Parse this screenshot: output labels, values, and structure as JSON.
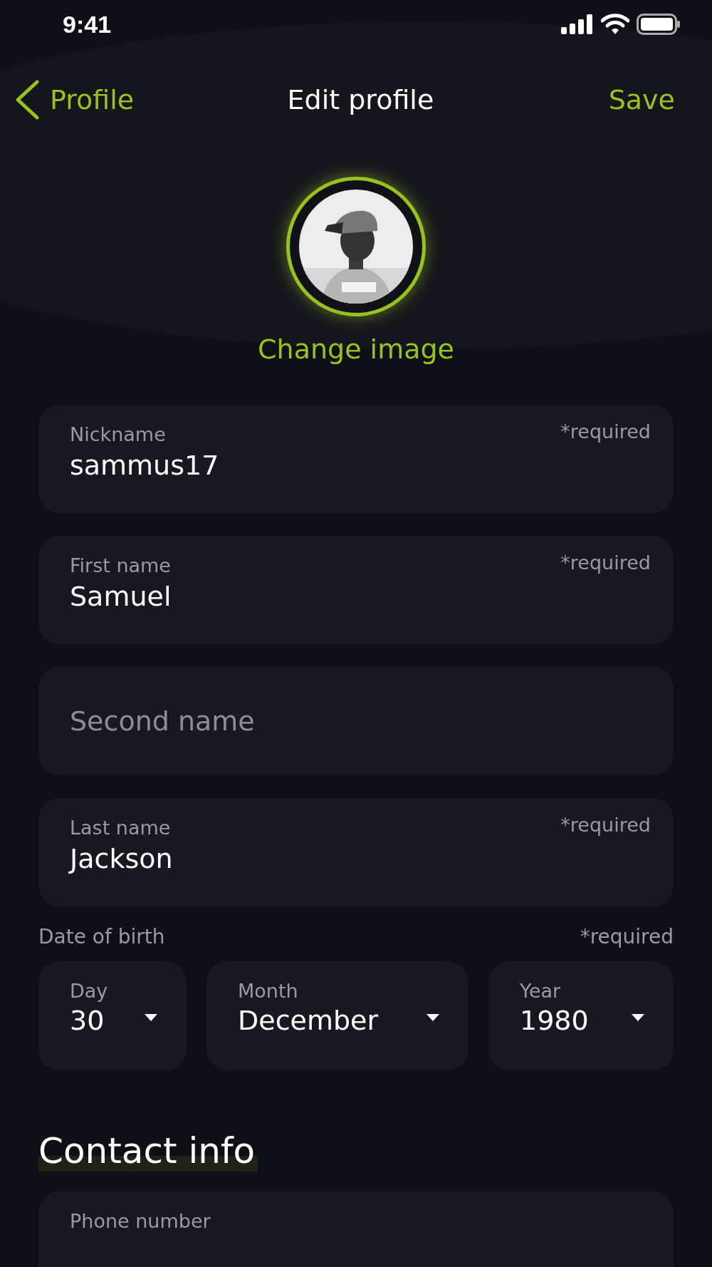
{
  "status_bar": {
    "time": "9:41"
  },
  "nav": {
    "back": "Profile",
    "title": "Edit profile",
    "action": "Save"
  },
  "avatar": {
    "change": "Change image"
  },
  "fields": [
    {
      "label": "Nickname",
      "value": "sammus17",
      "required": "*required"
    },
    {
      "label": "First name",
      "value": "Samuel",
      "required": "*required"
    },
    {
      "placeholder": "Second name"
    },
    {
      "label": "Last name",
      "value": "Jackson",
      "required": "*required"
    }
  ],
  "date_of_birth": {
    "label": "Date of birth",
    "required": "*required",
    "selects": [
      {
        "label": "Day",
        "value": "30"
      },
      {
        "label": "Month",
        "value": "December"
      },
      {
        "label": "Year",
        "value": "1980"
      }
    ]
  },
  "contact": {
    "heading": "Contact info",
    "fields": [
      {
        "label": "Phone number"
      }
    ]
  }
}
